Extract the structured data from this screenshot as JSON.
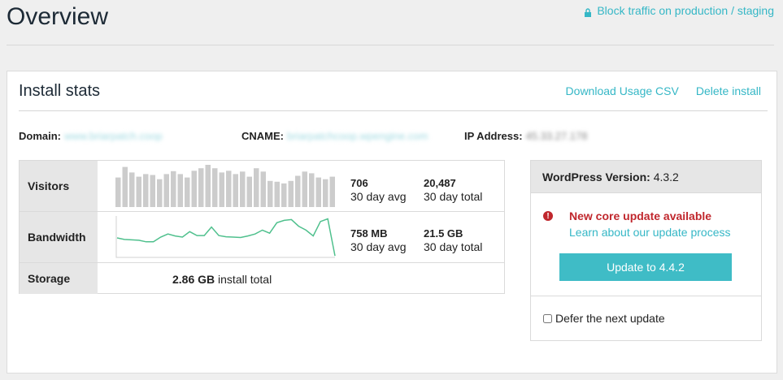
{
  "page": {
    "title": "Overview",
    "block_traffic_link": "Block traffic on production / staging"
  },
  "card": {
    "title": "Install stats",
    "actions": {
      "download_csv": "Download Usage CSV",
      "delete_install": "Delete install"
    },
    "domain": {
      "label": "Domain:",
      "value": "www.briarpatch.coop"
    },
    "cname": {
      "label": "CNAME:",
      "value": "briarpatchcoop.wpengine.com"
    },
    "ip": {
      "label": "IP Address:",
      "value": "45.33.27.178"
    }
  },
  "stats": {
    "visitors": {
      "label": "Visitors",
      "avg_value": "706",
      "avg_label": "30 day avg",
      "total_value": "20,487",
      "total_label": "30 day total",
      "series": [
        0.7,
        0.95,
        0.82,
        0.72,
        0.78,
        0.76,
        0.66,
        0.78,
        0.85,
        0.78,
        0.7,
        0.86,
        0.92,
        1.0,
        0.92,
        0.82,
        0.86,
        0.78,
        0.84,
        0.72,
        0.92,
        0.84,
        0.62,
        0.6,
        0.56,
        0.62,
        0.74,
        0.84,
        0.8,
        0.7,
        0.66,
        0.72
      ]
    },
    "bandwidth": {
      "label": "Bandwidth",
      "avg_value": "758 MB",
      "avg_label": "30 day avg",
      "total_value": "21.5 GB",
      "total_label": "30 day total",
      "series": [
        0.5,
        0.46,
        0.45,
        0.44,
        0.4,
        0.4,
        0.52,
        0.6,
        0.55,
        0.52,
        0.66,
        0.56,
        0.56,
        0.78,
        0.56,
        0.53,
        0.52,
        0.51,
        0.55,
        0.6,
        0.7,
        0.62,
        0.89,
        0.95,
        0.97,
        0.8,
        0.7,
        0.55,
        0.92,
        0.99,
        0.04
      ]
    },
    "storage": {
      "label": "Storage",
      "value": "2.86 GB",
      "suffix": "install total"
    }
  },
  "wordpress": {
    "version_label": "WordPress Version:",
    "version_value": "4.3.2",
    "alert_icon": "!",
    "alert_title": "New core update available",
    "alert_link": "Learn about our update process",
    "update_button": "Update to 4.4.2",
    "defer_label": "Defer the next update"
  },
  "colors": {
    "accent": "#35b7c6",
    "alert": "#c0272d",
    "bar": "#cccccc",
    "line": "#4fc08d"
  }
}
